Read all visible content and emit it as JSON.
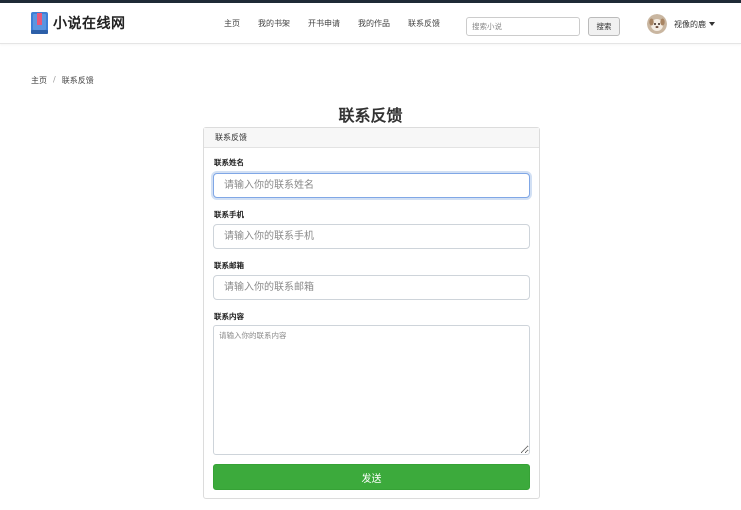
{
  "brand": {
    "name": "小说在线网",
    "icon": "book-icon",
    "accent": "#3d7fd6"
  },
  "nav": {
    "links": [
      "主页",
      "我的书架",
      "开书申请",
      "我的作品",
      "联系反馈"
    ],
    "search_placeholder": "搜索小说",
    "search_button": "搜索",
    "username": "视像的鹿"
  },
  "breadcrumb": {
    "home": "主页",
    "separator": "/",
    "current": "联系反馈"
  },
  "page_title": "联系反馈",
  "form": {
    "card_title": "联系反馈",
    "name_label": "联系姓名",
    "name_placeholder": "请输入你的联系姓名",
    "phone_label": "联系手机",
    "phone_placeholder": "请输入你的联系手机",
    "email_label": "联系邮箱",
    "email_placeholder": "请输入你的联系邮箱",
    "content_label": "联系内容",
    "content_placeholder": "请输入你的联系内容",
    "submit_label": "发送",
    "submit_color": "#3caa3c"
  }
}
